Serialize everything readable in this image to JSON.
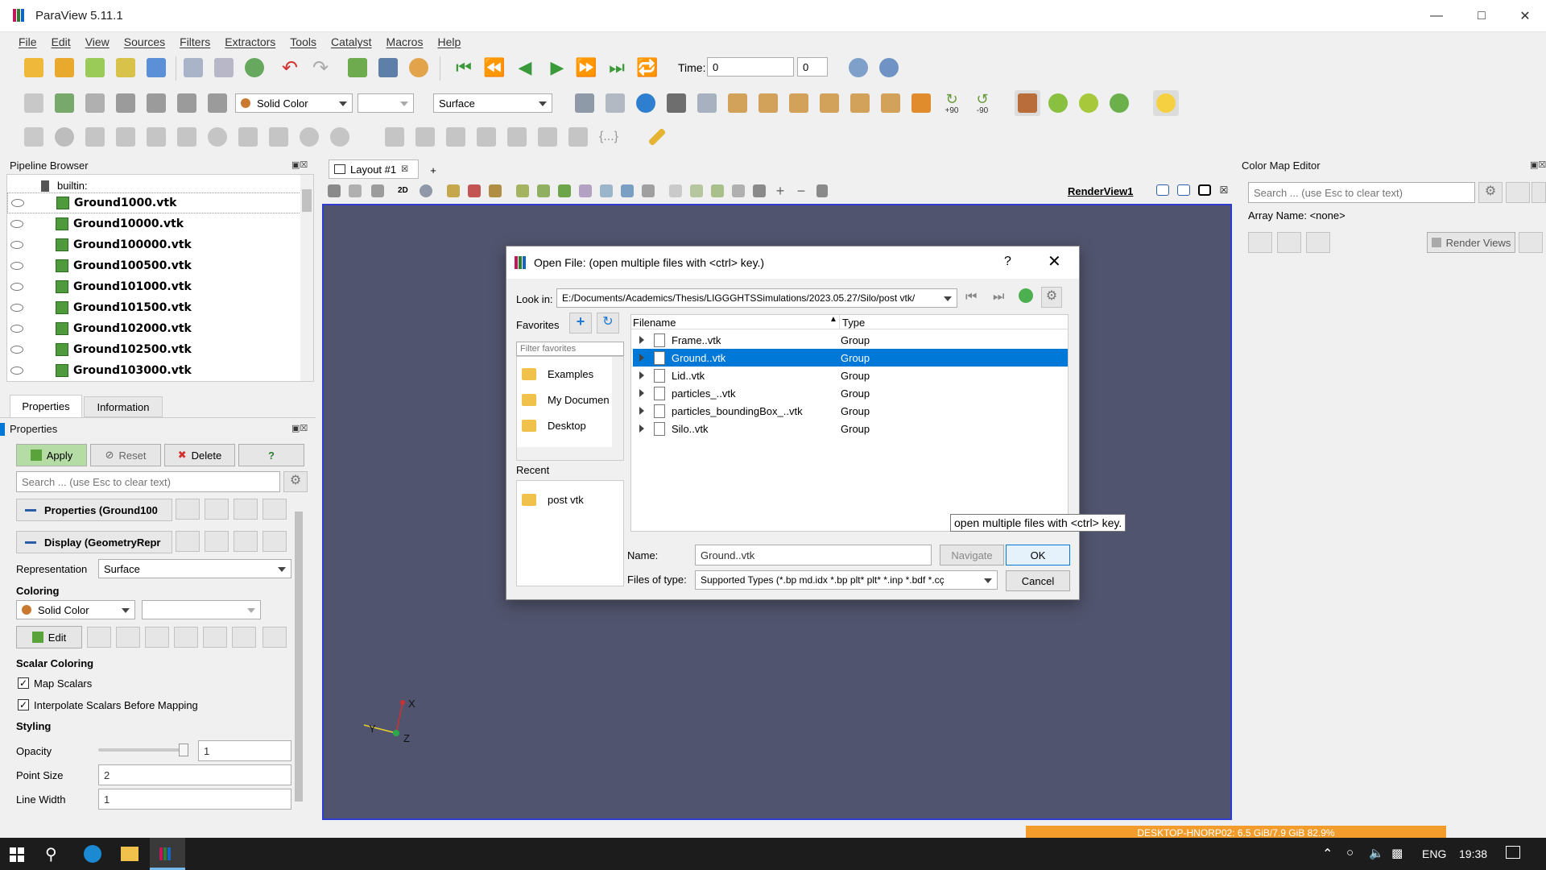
{
  "window": {
    "title": "ParaView 5.11.1"
  },
  "menu": [
    "File",
    "Edit",
    "View",
    "Sources",
    "Filters",
    "Extractors",
    "Tools",
    "Catalyst",
    "Macros",
    "Help"
  ],
  "toolbar": {
    "time_label": "Time:",
    "time_value": "0",
    "time_index": "0",
    "solid_color": "Solid Color",
    "representation": "Surface",
    "rot_pos": "+90",
    "rot_neg": "-90"
  },
  "pipeline": {
    "title": "Pipeline Browser",
    "root": "builtin:",
    "items": [
      "Ground1000.vtk",
      "Ground10000.vtk",
      "Ground100000.vtk",
      "Ground100500.vtk",
      "Ground101000.vtk",
      "Ground101500.vtk",
      "Ground102000.vtk",
      "Ground102500.vtk",
      "Ground103000.vtk"
    ]
  },
  "tabs": {
    "properties": "Properties",
    "information": "Information"
  },
  "properties": {
    "title": "Properties",
    "apply": "Apply",
    "reset": "Reset",
    "delete": "Delete",
    "help": "?",
    "search_placeholder": "Search ... (use Esc to clear text)",
    "section_properties": "Properties (Ground100",
    "section_display": "Display (GeometryRepr",
    "representation_label": "Representation",
    "representation_value": "Surface",
    "coloring_label": "Coloring",
    "coloring_value": "Solid Color",
    "edit": "Edit",
    "scalar_coloring": "Scalar Coloring",
    "map_scalars": "Map Scalars",
    "interpolate": "Interpolate Scalars Before Mapping",
    "styling": "Styling",
    "opacity_label": "Opacity",
    "opacity_value": "1",
    "point_size_label": "Point Size",
    "point_size_value": "2",
    "line_width_label": "Line Width",
    "line_width_value": "1"
  },
  "layout": {
    "tab": "Layout #1",
    "view_name": "RenderView1",
    "mode_2d": "2D",
    "add_tab": "+"
  },
  "colormap": {
    "title": "Color Map Editor",
    "search_placeholder": "Search ... (use Esc to clear text)",
    "array_name": "Array Name: <none>",
    "render_views": "Render Views"
  },
  "axes": {
    "x": "X",
    "y": "Y",
    "z": "Z"
  },
  "dialog": {
    "title": "Open File:  (open multiple files with <ctrl> key.)",
    "help": "?",
    "look_in_label": "Look in:",
    "look_in_value": "E:/Documents/Academics/Thesis/LIGGGHTSSimulations/2023.05.27/Silo/post vtk/",
    "favorites_label": "Favorites",
    "filter_placeholder": "Filter favorites",
    "favorites": [
      "Examples",
      "My Documen",
      "Desktop"
    ],
    "recent_label": "Recent",
    "recent": [
      "post vtk"
    ],
    "col_filename": "Filename",
    "col_type": "Type",
    "files": [
      {
        "name": "Frame..vtk",
        "type": "Group"
      },
      {
        "name": "Ground..vtk",
        "type": "Group"
      },
      {
        "name": "Lid..vtk",
        "type": "Group"
      },
      {
        "name": "particles_..vtk",
        "type": "Group"
      },
      {
        "name": "particles_boundingBox_..vtk",
        "type": "Group"
      },
      {
        "name": "Silo..vtk",
        "type": "Group"
      }
    ],
    "selected_index": 1,
    "name_label": "Name:",
    "name_value": "Ground..vtk",
    "navigate": "Navigate",
    "ok": "OK",
    "files_of_type_label": "Files of type:",
    "files_of_type_value": "Supported Types (*.bp md.idx *.bp plt* plt* *.inp *.bdf *.cç",
    "cancel": "Cancel",
    "tooltip": "open multiple files with <ctrl> key."
  },
  "status": {
    "memory": "DESKTOP-HNORP02: 6.5 GiB/7.9 GiB 82.9%"
  },
  "taskbar": {
    "lang": "ENG",
    "time": "19:38"
  },
  "colors": {
    "accent": "#0078d7",
    "render_bg": "#51546e",
    "memory_bar": "#f39c2c"
  }
}
